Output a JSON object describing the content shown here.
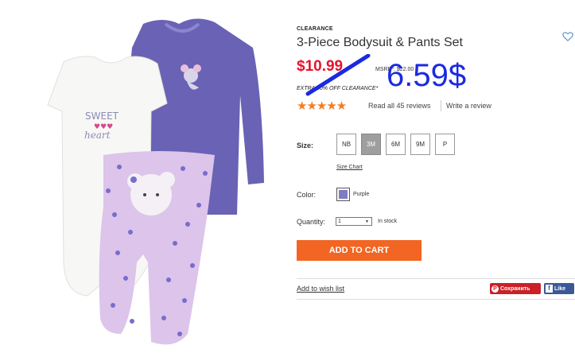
{
  "product": {
    "badge": "CLEARANCE",
    "title": "3-Piece Bodysuit & Pants Set",
    "price": "$10.99",
    "msrp": "MSRP*: $22.00",
    "handwritten_price": "6.59$",
    "extra_off": "EXTRA 40% OFF CLEARANCE*",
    "stars": "★★★★★",
    "rating": 5,
    "read_reviews": "Read all 45 reviews",
    "write_review": "Write a review"
  },
  "size": {
    "label": "Size:",
    "options": [
      "NB",
      "3M",
      "6M",
      "9M",
      "P"
    ],
    "selected": "3M",
    "chart_link": "Size Chart"
  },
  "color": {
    "label": "Color:",
    "name": "Purple",
    "swatch": "#7f7bc4"
  },
  "quantity": {
    "label": "Quantity:",
    "value": "1",
    "stock": "In stock"
  },
  "cart": {
    "button": "ADD TO CART",
    "accent": "#f26522"
  },
  "share": {
    "wish_list": "Add to wish list",
    "pinterest": "Сохранить",
    "facebook": "Like"
  },
  "colors": {
    "price_red": "#e8112d",
    "annotation_blue": "#1a2ae0",
    "star_orange": "#f47d20"
  }
}
